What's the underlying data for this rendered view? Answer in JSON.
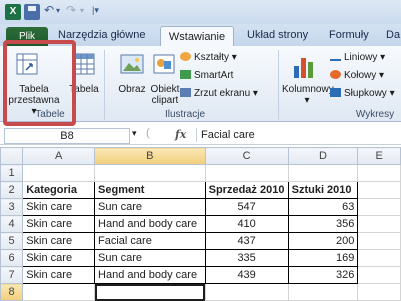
{
  "titlebar": {
    "app_icon_letter": "X"
  },
  "tabs": {
    "file": "Plik",
    "tools": "Narzędzia główne",
    "insert": "Wstawianie",
    "layout": "Układ strony",
    "formulas": "Formuły",
    "data": "Da"
  },
  "ribbon": {
    "tables_group": {
      "label": "Tabele",
      "pivot": "Tabela",
      "pivot_line2": "przestawna ▾",
      "table": "Tabela"
    },
    "illustrations_group": {
      "label": "Ilustracje",
      "picture": "Obraz",
      "clipart": "Obiekt",
      "clipart_line2": "clipart",
      "shapes": "Kształty ▾",
      "smartart": "SmartArt",
      "screenshot": "Zrzut ekranu ▾"
    },
    "charts_group": {
      "label": "Wykresy",
      "column": "Kolumnowy",
      "column_arrow": "▾",
      "line": "Liniowy ▾",
      "pie": "Kołowy ▾",
      "bar": "Słupkowy ▾"
    }
  },
  "formula_bar": {
    "name_box": "B8",
    "fx": "fx",
    "value": "Facial care"
  },
  "sheet": {
    "columns": [
      "A",
      "B",
      "C",
      "D",
      "E"
    ],
    "rows": [
      {
        "num": "1",
        "cells": [
          "",
          "",
          "",
          "",
          ""
        ]
      },
      {
        "num": "2",
        "cells": [
          "Kategoria",
          "Segment",
          "Sprzedaż 2010",
          "Sztuki 2010",
          ""
        ]
      },
      {
        "num": "3",
        "cells": [
          "Skin care",
          "Sun care",
          "547",
          "63",
          ""
        ]
      },
      {
        "num": "4",
        "cells": [
          "Skin care",
          "Hand and body care",
          "410",
          "356",
          ""
        ]
      },
      {
        "num": "5",
        "cells": [
          "Skin care",
          "Facial care",
          "437",
          "200",
          ""
        ]
      },
      {
        "num": "6",
        "cells": [
          "Skin care",
          "Sun care",
          "335",
          "169",
          ""
        ]
      },
      {
        "num": "7",
        "cells": [
          "Skin care",
          "Hand and body care",
          "439",
          "326",
          ""
        ]
      },
      {
        "num": "8",
        "cells": [
          "",
          "",
          "",
          "",
          ""
        ]
      }
    ]
  },
  "colors": {
    "highlight": "#c74a4d",
    "file_tab": "#1d5a2b"
  }
}
